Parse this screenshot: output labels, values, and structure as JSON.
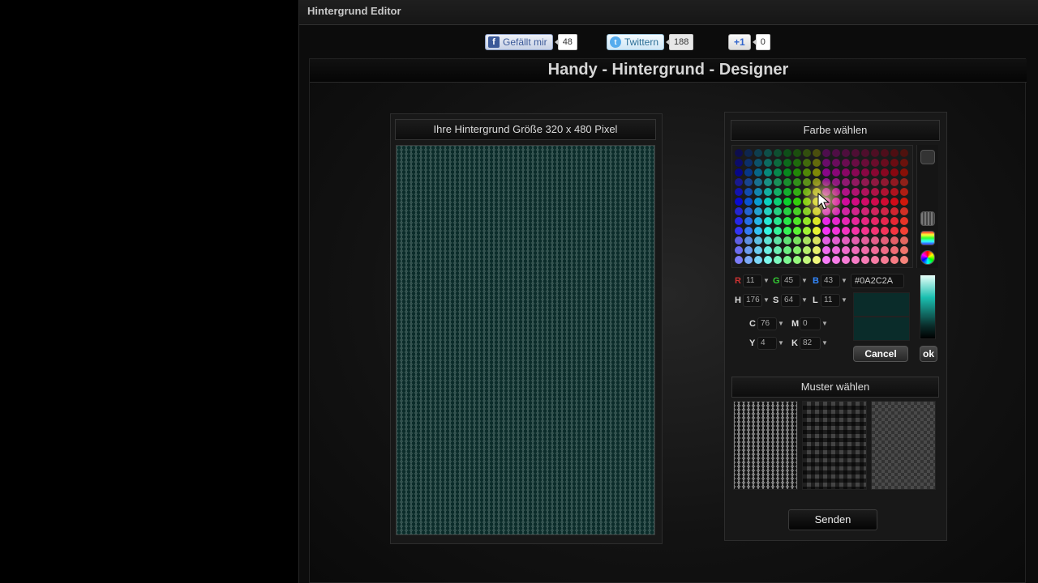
{
  "window": {
    "title": "Hintergrund Editor"
  },
  "social": {
    "facebook": {
      "label": "Gefällt mir",
      "count": "48"
    },
    "twitter": {
      "label": "Twittern",
      "count": "188"
    },
    "googleplus": {
      "label": "+1",
      "count": "0"
    }
  },
  "main": {
    "title": "Handy - Hintergrund - Designer"
  },
  "preview": {
    "heading": "Ihre Hintergrund Größe 320 x 480 Pixel"
  },
  "color_picker": {
    "heading": "Farbe wählen",
    "r": "11",
    "g": "45",
    "b": "43",
    "h": "176",
    "s": "64",
    "l": "11",
    "c": "76",
    "m": "0",
    "y": "4",
    "k": "82",
    "hex": "#0A2C2A",
    "labels": {
      "r": "R",
      "g": "G",
      "b": "B",
      "h": "H",
      "s": "S",
      "l": "L",
      "c": "C",
      "m": "M",
      "y": "Y",
      "k": "K"
    },
    "cancel_label": "Cancel",
    "ok_label": "ok",
    "selected_color": "#0A2C2A"
  },
  "patterns": {
    "heading": "Muster wählen"
  },
  "send_label": "Senden"
}
